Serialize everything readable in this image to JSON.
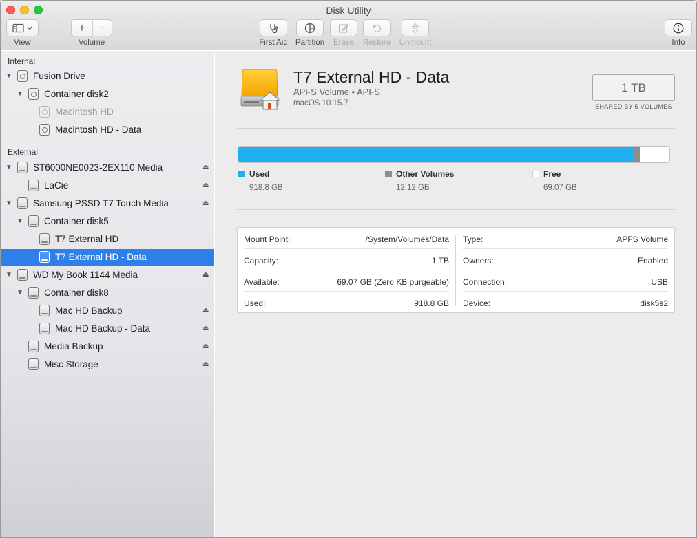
{
  "window": {
    "title": "Disk Utility"
  },
  "toolbar": {
    "view_label": "View",
    "volume_label": "Volume",
    "first_aid_label": "First Aid",
    "partition_label": "Partition",
    "erase_label": "Erase",
    "restore_label": "Restore",
    "unmount_label": "Unmount",
    "info_label": "Info",
    "add_glyph": "+",
    "remove_glyph": "−"
  },
  "sidebar": {
    "internal_label": "Internal",
    "external_label": "External",
    "items": [
      {
        "label": "Fusion Drive"
      },
      {
        "label": "Container disk2"
      },
      {
        "label": "Macintosh HD"
      },
      {
        "label": "Macintosh HD - Data"
      },
      {
        "label": "ST6000NE0023-2EX110 Media"
      },
      {
        "label": "LaCie"
      },
      {
        "label": "Samsung PSSD T7 Touch Media"
      },
      {
        "label": "Container disk5"
      },
      {
        "label": "T7 External HD"
      },
      {
        "label": "T7 External HD - Data"
      },
      {
        "label": "WD My Book 1144 Media"
      },
      {
        "label": "Container disk8"
      },
      {
        "label": "Mac HD Backup"
      },
      {
        "label": "Mac HD Backup - Data"
      },
      {
        "label": "Media Backup"
      },
      {
        "label": "Misc Storage"
      }
    ]
  },
  "volume": {
    "name": "T7 External HD - Data",
    "subtitle": "APFS Volume • APFS",
    "os": "macOS 10.15.7",
    "size": "1 TB",
    "size_caption": "SHARED BY 5 VOLUMES"
  },
  "usage": {
    "used": {
      "label": "Used",
      "value": "918.8 GB",
      "fraction": 0.9188,
      "color": "#1fb0f0"
    },
    "other": {
      "label": "Other Volumes",
      "value": "12.12 GB",
      "fraction": 0.01212,
      "color": "#8e8e8e"
    },
    "free": {
      "label": "Free",
      "value": "69.07 GB",
      "fraction": 0.06907,
      "color": "#ffffff"
    }
  },
  "info": {
    "left": [
      {
        "key": "Mount Point:",
        "value": "/System/Volumes/Data"
      },
      {
        "key": "Capacity:",
        "value": "1 TB"
      },
      {
        "key": "Available:",
        "value": "69.07 GB (Zero KB purgeable)"
      },
      {
        "key": "Used:",
        "value": "918.8 GB"
      }
    ],
    "right": [
      {
        "key": "Type:",
        "value": "APFS Volume"
      },
      {
        "key": "Owners:",
        "value": "Enabled"
      },
      {
        "key": "Connection:",
        "value": "USB"
      },
      {
        "key": "Device:",
        "value": "disk5s2"
      }
    ]
  }
}
